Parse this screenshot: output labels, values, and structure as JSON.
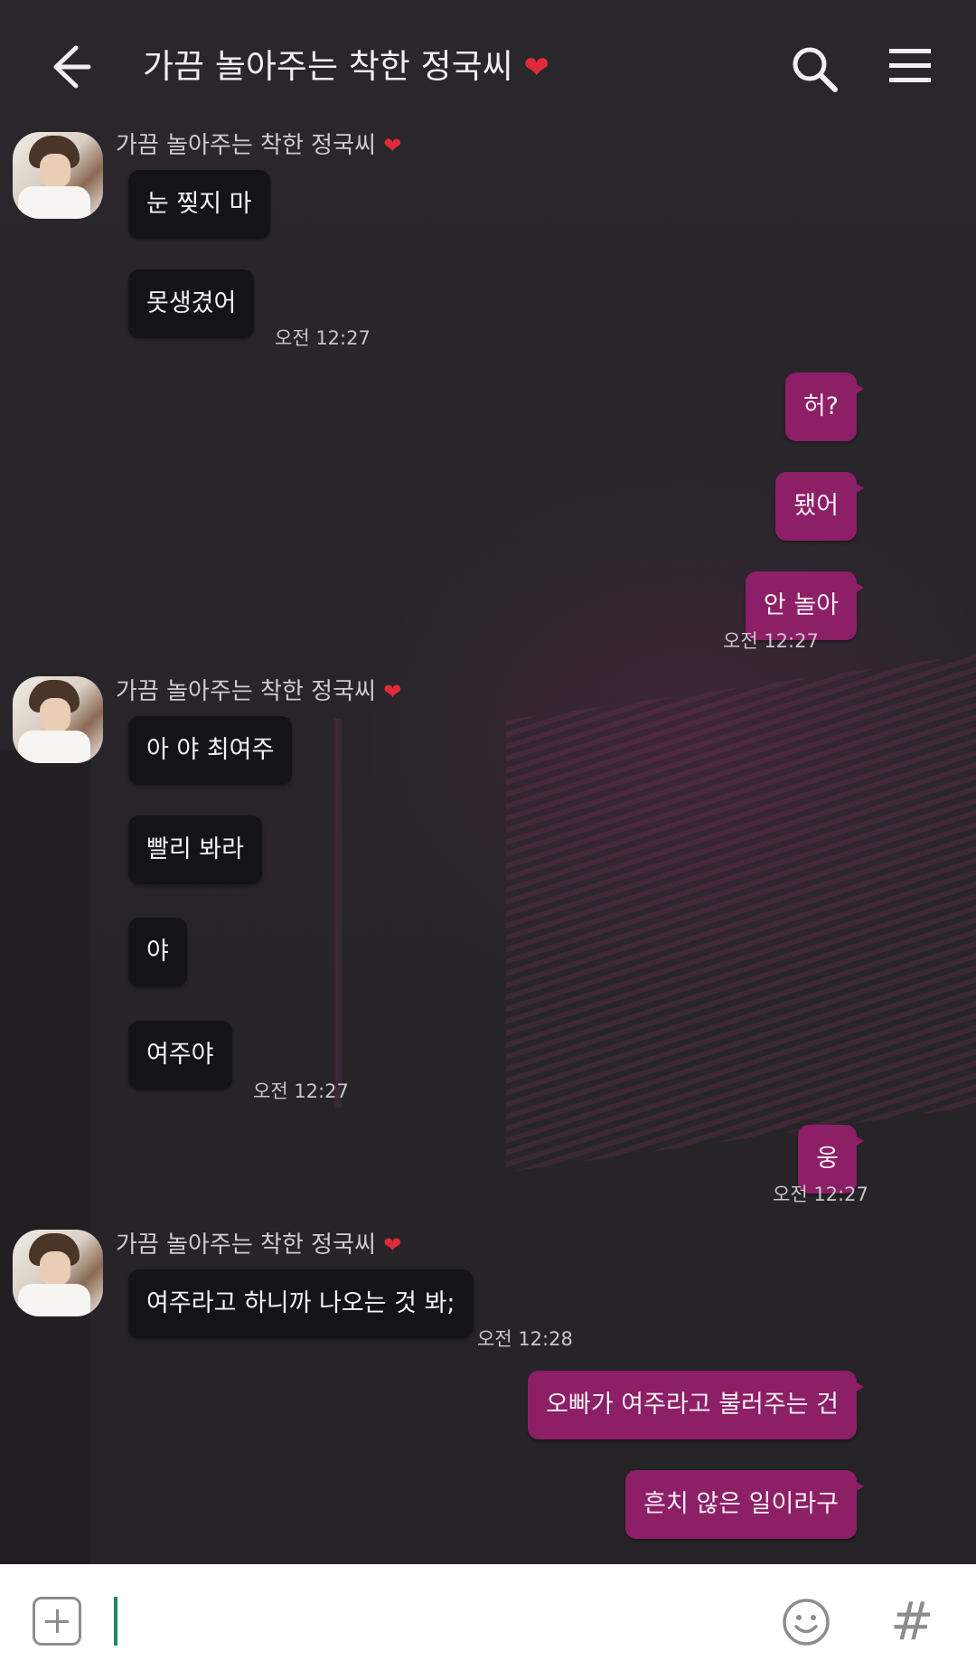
{
  "header": {
    "title": "가끔 놀아주는 착한 정국씨",
    "title_heart": "❤"
  },
  "contact": {
    "name": "가끔 놀아주는 착한 정국씨",
    "heart": "❤"
  },
  "messages": {
    "g1": {
      "m1": "눈 찢지 마",
      "m2": "못생겼어",
      "time": "오전 12:27"
    },
    "o1": {
      "m1": "허?",
      "m2": "됐어",
      "m3": "안 놀아",
      "time": "오전 12:27"
    },
    "g2": {
      "m1": "아 야 최여주",
      "m2": "빨리 봐라",
      "m3": "야",
      "m4": "여주야",
      "time": "오전 12:27"
    },
    "o2": {
      "m1": "웅",
      "time": "오전 12:27"
    },
    "g3": {
      "m1": "여주라고 하니까 나오는 것 봐;",
      "time": "오전 12:28"
    },
    "o3": {
      "m1": "오빠가 여주라고 불러주는 건",
      "m2": "흔치 않은 일이라구"
    }
  },
  "input": {
    "value": "",
    "placeholder": ""
  },
  "icons": {
    "back": "arrow-left-icon",
    "search": "search-icon",
    "menu": "hamburger-icon",
    "plus": "plus-icon",
    "emoji": "emoji-icon",
    "hashtag": "hashtag-icon"
  },
  "colors": {
    "outgoing_bubble": "#8c1f66",
    "incoming_bubble": "#141315",
    "heart": "#e02a3c",
    "cursor": "#1c8a6a"
  }
}
